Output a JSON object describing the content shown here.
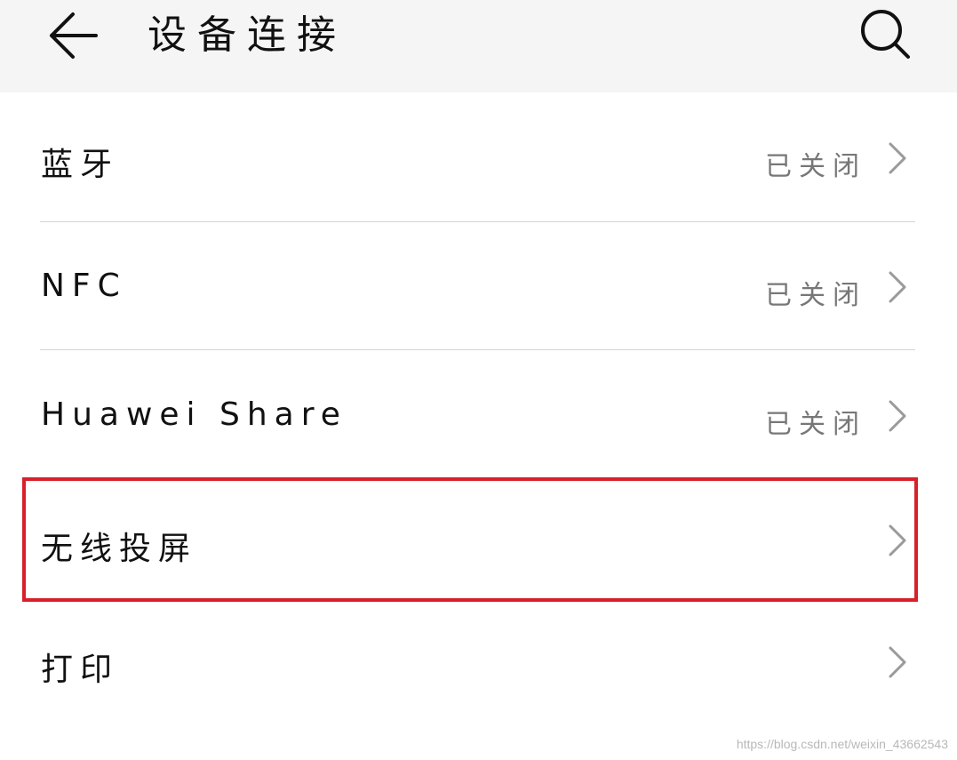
{
  "header": {
    "title": "设备连接",
    "back_icon": "arrow-left-icon",
    "search_icon": "search-icon"
  },
  "rows": [
    {
      "label": "蓝牙",
      "status": "已关闭"
    },
    {
      "label": "NFC",
      "status": "已关闭"
    },
    {
      "label": "Huawei Share",
      "status": "已关闭"
    },
    {
      "label": "无线投屏",
      "status": ""
    },
    {
      "label": "打印",
      "status": ""
    }
  ],
  "highlight": {
    "target": "无线投屏",
    "color": "#d8202a"
  },
  "watermark": "https://blog.csdn.net/weixin_43662543"
}
